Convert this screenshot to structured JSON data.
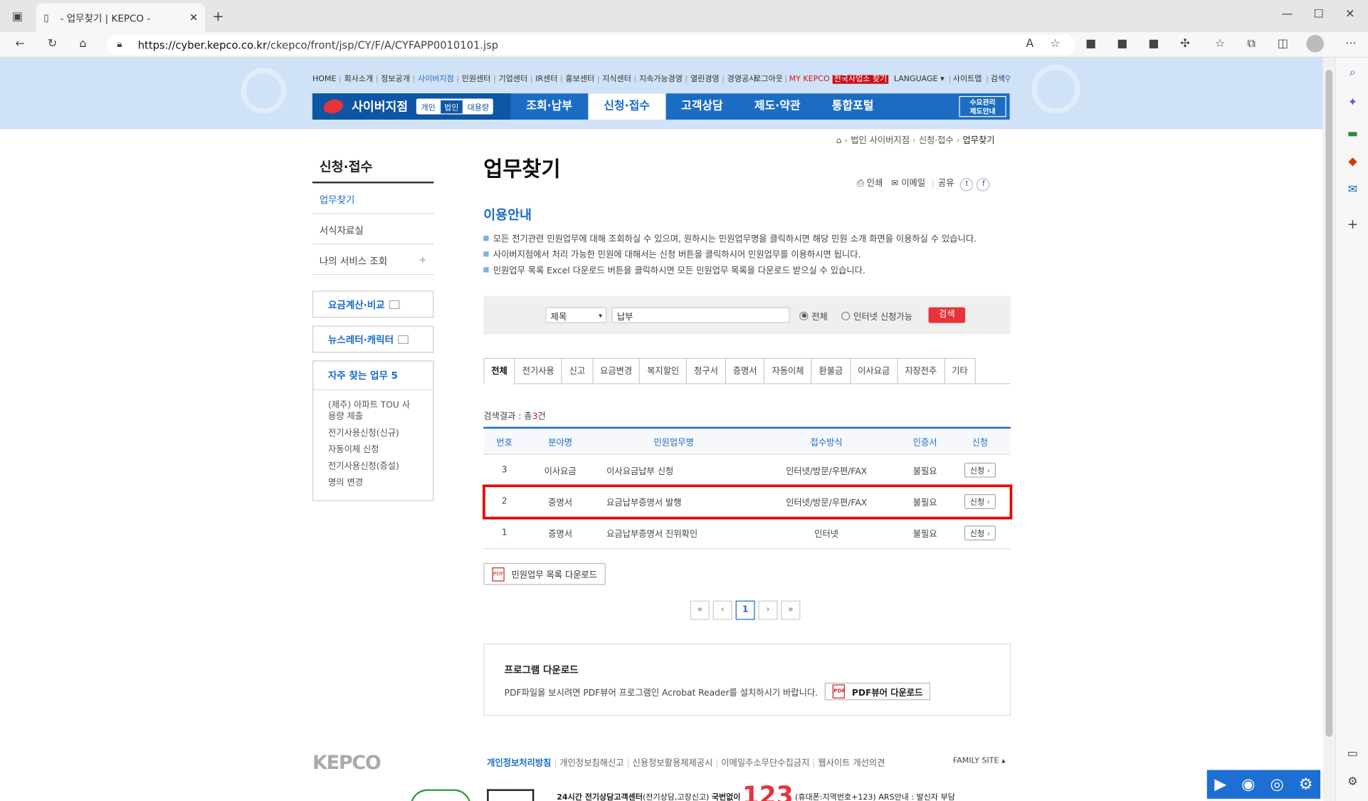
{
  "browser": {
    "tab_title": "- 업무찾기 | KEPCO -",
    "url_host": "https://cyber.kepco.co.kr",
    "url_path": "/ckepco/front/jsp/CY/F/A/CYFAPP0010101.jsp"
  },
  "util": {
    "items": [
      "HOME",
      "회사소개",
      "정보공개",
      "사이버지점",
      "민원센터",
      "기업센터",
      "IR센터",
      "홍보센터",
      "지식센터",
      "지속가능경영",
      "열린경영",
      "경영공시"
    ],
    "login": "로그아웃",
    "my": "MY KEPCO",
    "national": "전국사업소 찾기",
    "language": "LANGUAGE",
    "sitemap": "사이트맵",
    "search": "검색"
  },
  "nav": {
    "brand": "사이버지점",
    "seg": [
      "개인",
      "법인",
      "대용량"
    ],
    "menu": [
      "조회·납부",
      "신청·접수",
      "고객상담",
      "제도·약관",
      "통합포털"
    ],
    "btn1": "수요관리",
    "btn2": "제도안내"
  },
  "crumb": [
    "법인 사이버지점",
    "신청·접수",
    "업무찾기"
  ],
  "left": {
    "title": "신청·접수",
    "items": [
      "업무찾기",
      "서식자료실",
      "나의 서비스 조회"
    ],
    "plus": "+",
    "box1": "요금계산·비교",
    "box2": "뉴스레터·캐릭터",
    "faq_title": "자주 찾는 업무 5",
    "faq": [
      "(제주) 아파트 TOU 사용량 제출",
      "전기사용신청(신규)",
      "자동이체 신청",
      "전기사용신청(증설)",
      "명의 변경"
    ]
  },
  "main": {
    "title": "업무찾기",
    "share": {
      "print": "인쇄",
      "email": "이메일",
      "share": "공유"
    },
    "guide_title": "이용안내",
    "guide": [
      "모든 전기관련 민원업무에 대해 조회하실 수 있으며, 원하시는 민원업무명을 클릭하시면 해당 민원 소개 화면을 이용하실 수 있습니다.",
      "사이버지점에서 처리 가능한 민원에 대해서는 신청 버튼을 클릭하시어 민원업무를 이용하시면 됩니다.",
      "민원업무 목록 Excel 다운로드 버튼을 클릭하시면 모든 민원업무 목록을 다운로드 받으실 수 있습니다."
    ],
    "search": {
      "select": "제목",
      "value": "납부",
      "radio_all": "전체",
      "radio_net": "인터넷 신청가능",
      "button": "검색"
    },
    "tabs": [
      "전체",
      "전기사용",
      "신고",
      "요금변경",
      "복지할인",
      "청구서",
      "증명서",
      "자동이체",
      "환불금",
      "이사요금",
      "지장전주",
      "기타"
    ],
    "result_prefix": "검색결과 : 총",
    "result_count": "3",
    "result_suffix": "건",
    "headers": [
      "번호",
      "분야명",
      "민원업무명",
      "접수방식",
      "인증서",
      "신청"
    ],
    "rows": [
      [
        "3",
        "이사요금",
        "이사요금납부 신청",
        "인터넷/방문/우편/FAX",
        "불필요",
        "신청"
      ],
      [
        "2",
        "증명서",
        "요금납부증명서 발행",
        "인터넷/방문/우편/FAX",
        "불필요",
        "신청"
      ],
      [
        "1",
        "증명서",
        "요금납부증명서 진위확인",
        "인터넷",
        "불필요",
        "신청"
      ]
    ],
    "download": "민원업무 목록 다운로드",
    "page": "1",
    "program": {
      "title": "프로그램 다운로드",
      "desc": "PDF파일을 보시려면 PDF뷰어 프로그램인 Acrobat Reader를 설치하시기 바랍니다.",
      "button": "PDF뷰어 다운로드"
    }
  },
  "footer": {
    "logo": "KEPCO",
    "links": [
      "개인정보처리방침",
      "개인정보침해신고",
      "신용정보활용체제공시",
      "이메일주소무단수집금지",
      "웹사이트 개선의견"
    ],
    "family": "FAMILY SITE",
    "callcenter": "24시간 전기상담고객센터",
    "callsub": "(전기상담,고장신고)",
    "nationwide": "국번없이",
    "num": "123",
    "extra": "(휴대폰:지역번호+123) ARS안내 : 발신자 부담"
  }
}
